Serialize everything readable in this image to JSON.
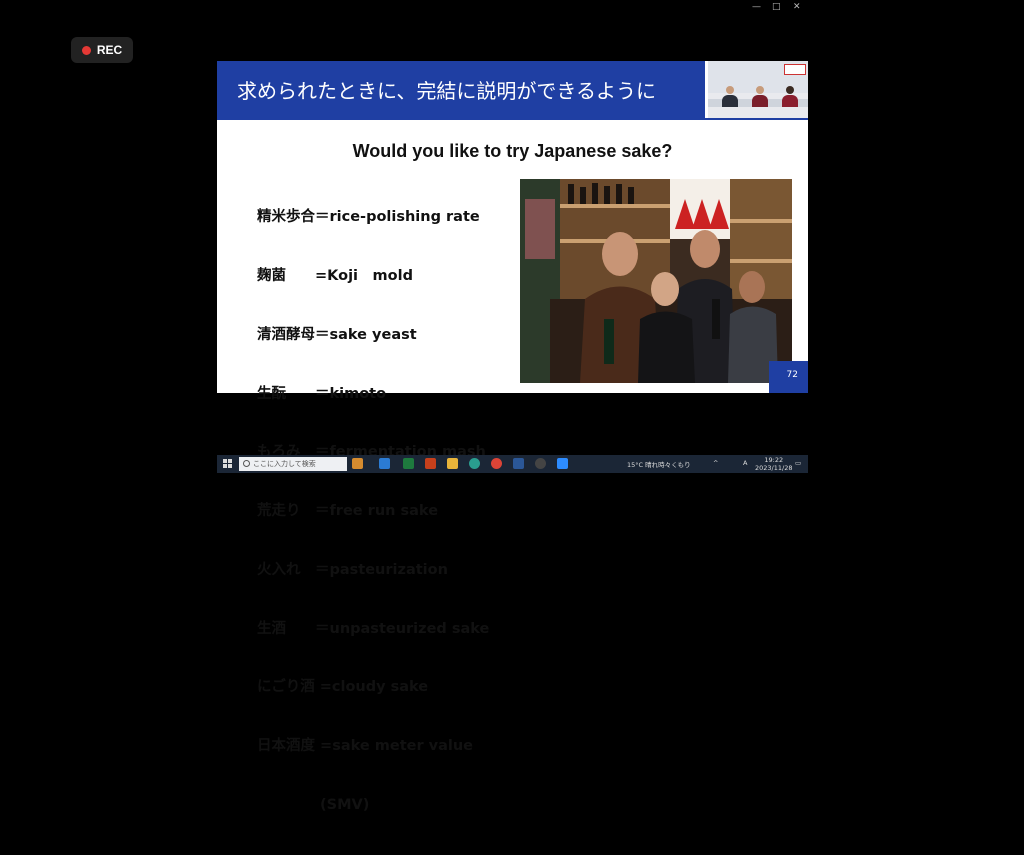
{
  "window": {
    "minimize": "—",
    "maximize": "□",
    "close": "✕"
  },
  "recording": {
    "label": "REC"
  },
  "slide": {
    "banner_title": "求められたときに、完結に説明ができるように",
    "heading": "Would you like to try Japanese sake?",
    "terms": [
      "精米歩合＝rice-polishing rate",
      "麹菌　　=Koji　mold",
      "清酒酵母＝sake yeast",
      "生酛　　＝kimoto",
      "もろみ　＝fermentation mash",
      "荒走り　＝free run sake",
      "火入れ　＝pasteurization",
      "生酒　　＝unpasteurized sake",
      "にごり酒 =cloudy sake",
      "日本酒度 =sake meter value",
      "　　　　 (SMV)"
    ],
    "page_number": "72"
  },
  "taskbar": {
    "search_placeholder": "ここに入力して検索",
    "weather": "15°C  晴れ時々くもり",
    "ime": "A",
    "time": "19:22",
    "date": "2023/11/28"
  }
}
